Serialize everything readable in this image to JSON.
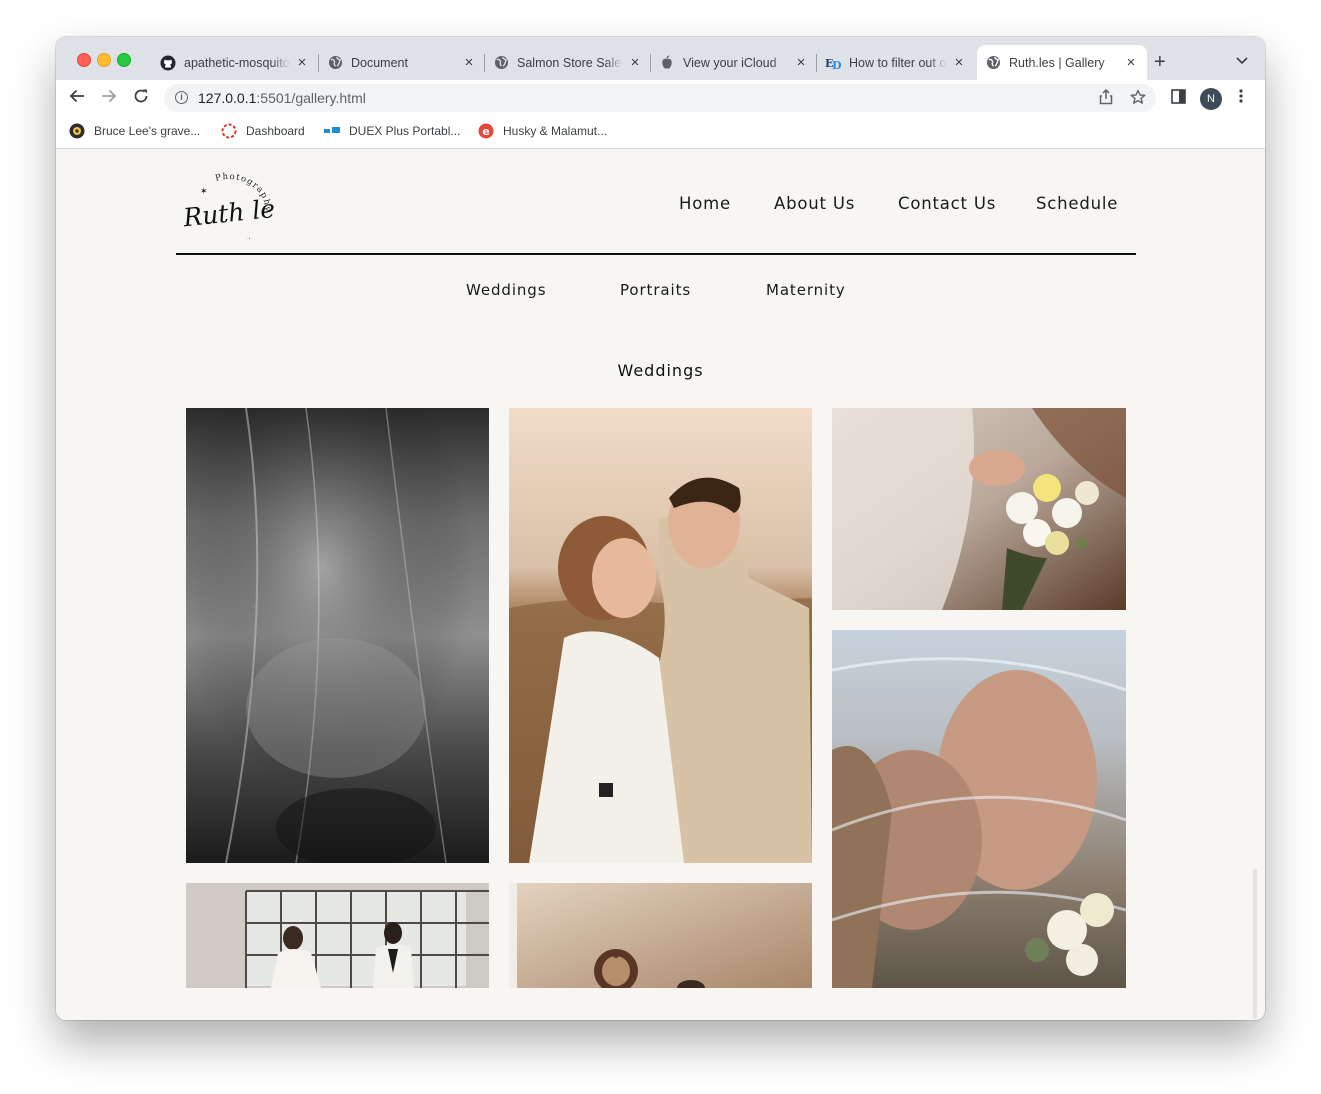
{
  "browser": {
    "tabs": [
      {
        "title": "apathetic-mosquito",
        "icon": "github-icon",
        "active": false
      },
      {
        "title": "Document",
        "icon": "globe-icon",
        "active": false
      },
      {
        "title": "Salmon Store Sales",
        "icon": "globe-icon",
        "active": false
      },
      {
        "title": "View your iCloud",
        "icon": "apple-icon",
        "active": false
      },
      {
        "title": "How to filter out o",
        "icon": "ed-icon",
        "active": false
      },
      {
        "title": "Ruth.les | Gallery",
        "icon": "globe-icon",
        "active": true
      }
    ],
    "new_tab_label": "+",
    "url_host": "127.0.0.1",
    "url_path": ":5501/gallery.html",
    "profile_initial": "N",
    "bookmarks": [
      {
        "label": "Bruce Lee's grave...",
        "icon": "bookmark-favicon-icon"
      },
      {
        "label": "Dashboard",
        "icon": "dashboard-favicon-icon"
      },
      {
        "label": "DUEX Plus Portabl...",
        "icon": "duex-favicon-icon"
      },
      {
        "label": "Husky & Malamut...",
        "icon": "husky-favicon-icon"
      }
    ]
  },
  "site": {
    "logo": {
      "script_text": "Ruth les",
      "arc_text": "Photography"
    },
    "nav": [
      "Home",
      "About Us",
      "Contact Us",
      "Schedule"
    ],
    "categories": [
      "Weddings",
      "Portraits",
      "Maternity"
    ],
    "gallery_title": "Weddings",
    "photos": [
      {
        "subject": "black-and-white bride under veil"
      },
      {
        "subject": "couple embracing at sunset"
      },
      {
        "subject": "bride holding bouquet"
      },
      {
        "subject": "couple kissing under veil"
      },
      {
        "subject": "couple walking by large windows"
      },
      {
        "subject": "interior with wall decor"
      }
    ]
  },
  "colors": {
    "page_bg": "#f7f6f2",
    "tabstrip_bg": "#dee1e6",
    "text": "#1a1a1a"
  }
}
